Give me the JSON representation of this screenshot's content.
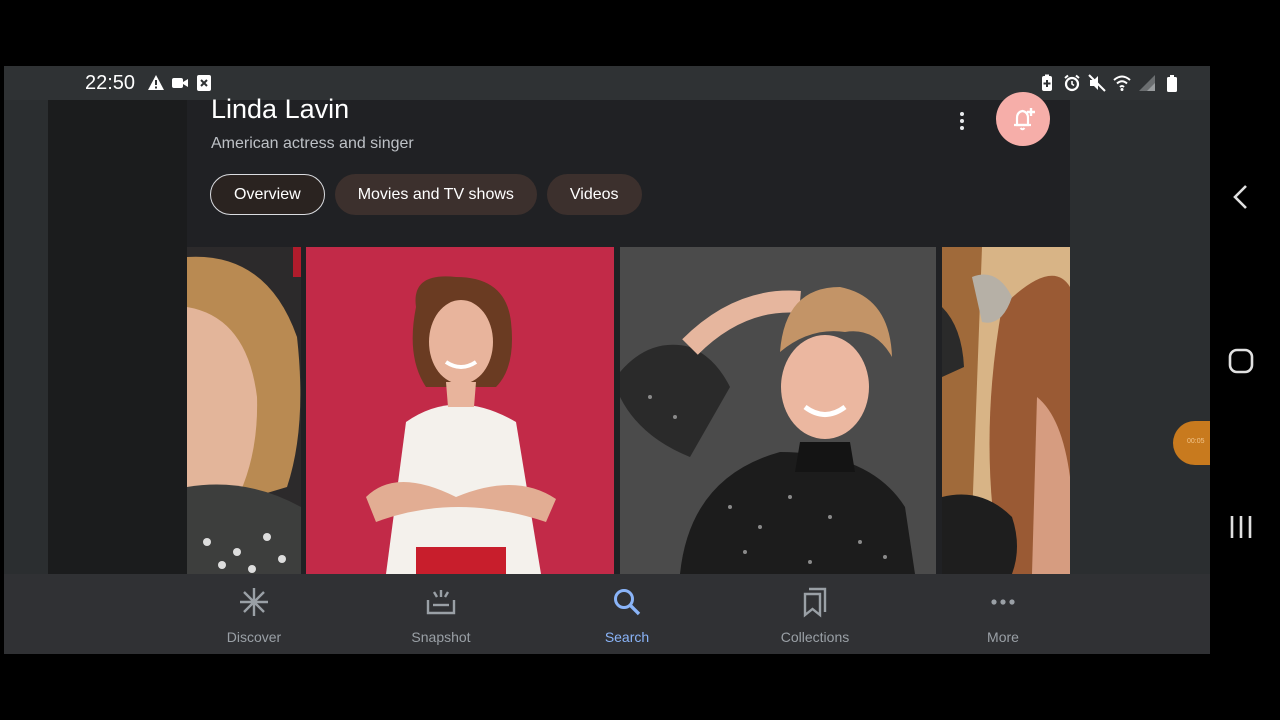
{
  "status_bar": {
    "time": "22:50",
    "left_icons": [
      "warning-icon",
      "video-camera-icon",
      "close-box-icon"
    ],
    "right_icons": [
      "battery-saver-icon",
      "alarm-icon",
      "mute-icon",
      "wifi-icon",
      "signal-icon",
      "battery-icon"
    ]
  },
  "entity": {
    "title": "Linda Lavin",
    "subtitle": "American actress and singer"
  },
  "actions": {
    "more_icon": "more-vertical-icon",
    "follow_icon": "notification-add-icon",
    "follow_color": "#f6aea9"
  },
  "tabs": [
    {
      "label": "Overview",
      "active": true
    },
    {
      "label": "Movies and TV shows",
      "active": false
    },
    {
      "label": "Videos",
      "active": false
    }
  ],
  "photos": [
    "photo-1",
    "photo-2",
    "photo-3",
    "photo-4"
  ],
  "side_handle": {
    "text": "00:05"
  },
  "bottom_nav": [
    {
      "label": "Discover",
      "icon": "asterisk-icon",
      "active": false
    },
    {
      "label": "Snapshot",
      "icon": "snapshot-icon",
      "active": false
    },
    {
      "label": "Search",
      "icon": "search-icon",
      "active": true
    },
    {
      "label": "Collections",
      "icon": "bookmarks-icon",
      "active": false
    },
    {
      "label": "More",
      "icon": "more-horizontal-icon",
      "active": false
    }
  ],
  "system_nav": [
    "back-icon",
    "home-icon",
    "recents-icon"
  ],
  "colors": {
    "accent": "#8ab4f8",
    "tab_bg": "#3c302d",
    "background": "#202124"
  }
}
